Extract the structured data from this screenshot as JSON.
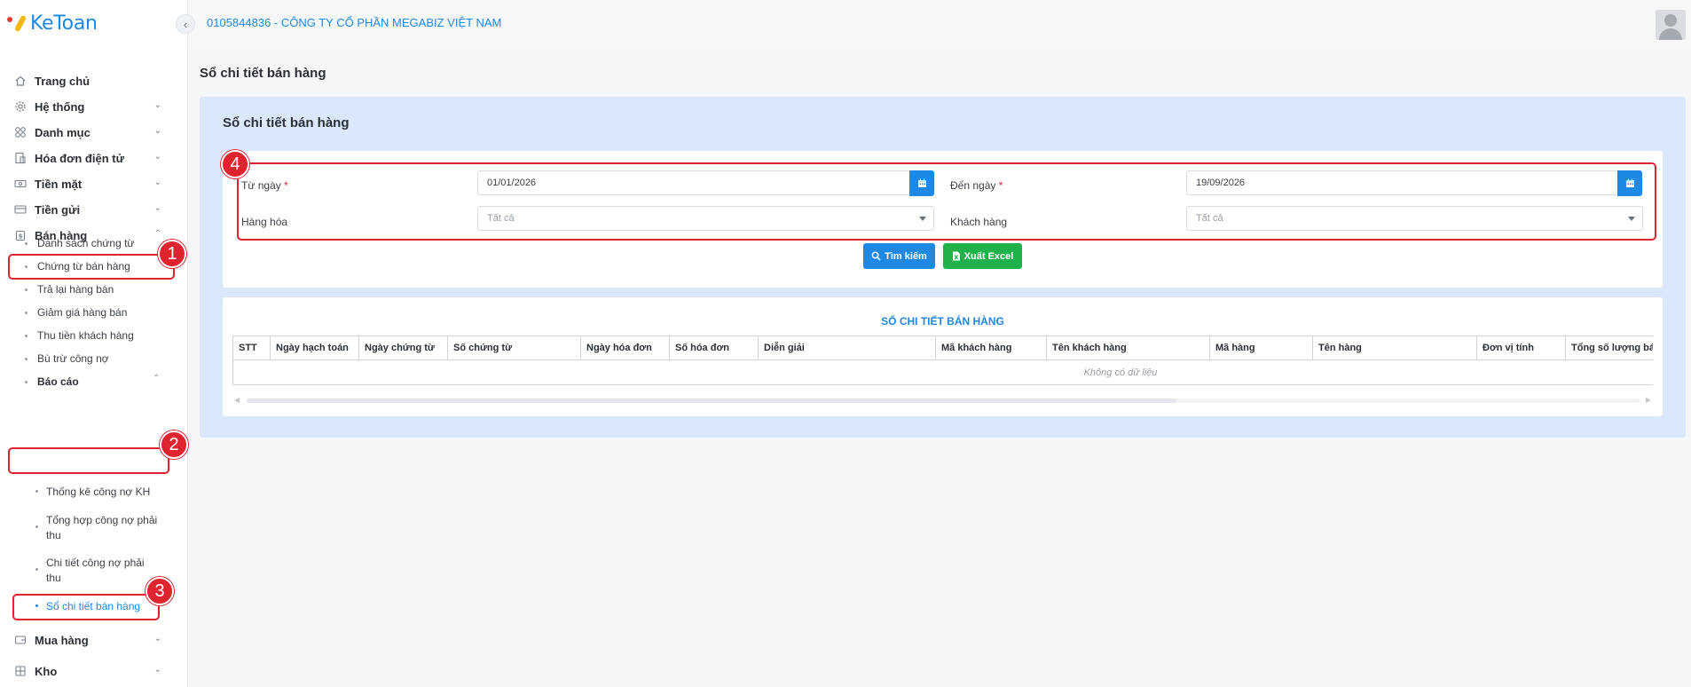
{
  "app": {
    "logo_text": "KeToan",
    "company": "0105844836 - CÔNG TY CỔ PHẦN MEGABIZ VIỆT NAM"
  },
  "sidebar": {
    "items": [
      {
        "label": "Trang chủ",
        "icon": "home-icon"
      },
      {
        "label": "Hệ thống",
        "icon": "gear-icon"
      },
      {
        "label": "Danh mục",
        "icon": "grid-icon"
      },
      {
        "label": "Hóa đơn điện tử",
        "icon": "invoice-icon"
      },
      {
        "label": "Tiền mặt",
        "icon": "cash-icon"
      },
      {
        "label": "Tiền gửi",
        "icon": "card-icon"
      },
      {
        "label": "Bán hàng",
        "icon": "sales-icon"
      }
    ],
    "sales_sub": [
      "Danh sách chứng từ",
      "Chứng từ bán hàng",
      "Trả lại hàng bán",
      "Giảm giá hàng bán",
      "Thu tiền khách hàng",
      "Bù trừ công nợ",
      "Báo cáo"
    ],
    "report_sub": [
      "Thống kê công nợ KH",
      "Tổng hợp công nợ phải thu",
      "Chi tiết công nợ phải thu",
      "Sổ chi tiết bán hàng"
    ],
    "bottom_items": [
      {
        "label": "Mua hàng",
        "icon": "wallet-icon"
      },
      {
        "label": "Kho",
        "icon": "warehouse-icon"
      }
    ]
  },
  "badges": [
    "1",
    "2",
    "3",
    "4"
  ],
  "page": {
    "title": "Sổ chi tiết bán hàng",
    "panel_title": "Sổ chi tiết bán hàng"
  },
  "filters": {
    "from_label": "Từ ngày",
    "from_value": "01/01/2026",
    "to_label": "Đến ngày",
    "to_value": "19/09/2026",
    "goods_label": "Hàng hóa",
    "goods_placeholder": "Tất cả",
    "customer_label": "Khách hàng",
    "customer_placeholder": "Tất cả",
    "required_mark": "*"
  },
  "buttons": {
    "search": "Tìm kiếm",
    "excel": "Xuất Excel"
  },
  "table": {
    "title": "SỔ CHI TIẾT BÁN HÀNG",
    "columns": [
      "STT",
      "Ngày hạch toán",
      "Ngày chứng từ",
      "Số chứng từ",
      "Ngày hóa đơn",
      "Số hóa đơn",
      "Diễn giải",
      "Mã khách hàng",
      "Tên khách hàng",
      "Mã hàng",
      "Tên hàng",
      "Đơn vị tính",
      "Tổng số lượng bán"
    ],
    "empty_text": "Không có dữ liệu"
  },
  "colors": {
    "accent": "#1e88e5",
    "excel": "#21b14a",
    "annotation": "#e0242f",
    "panel_bg": "#dbe8fb"
  }
}
